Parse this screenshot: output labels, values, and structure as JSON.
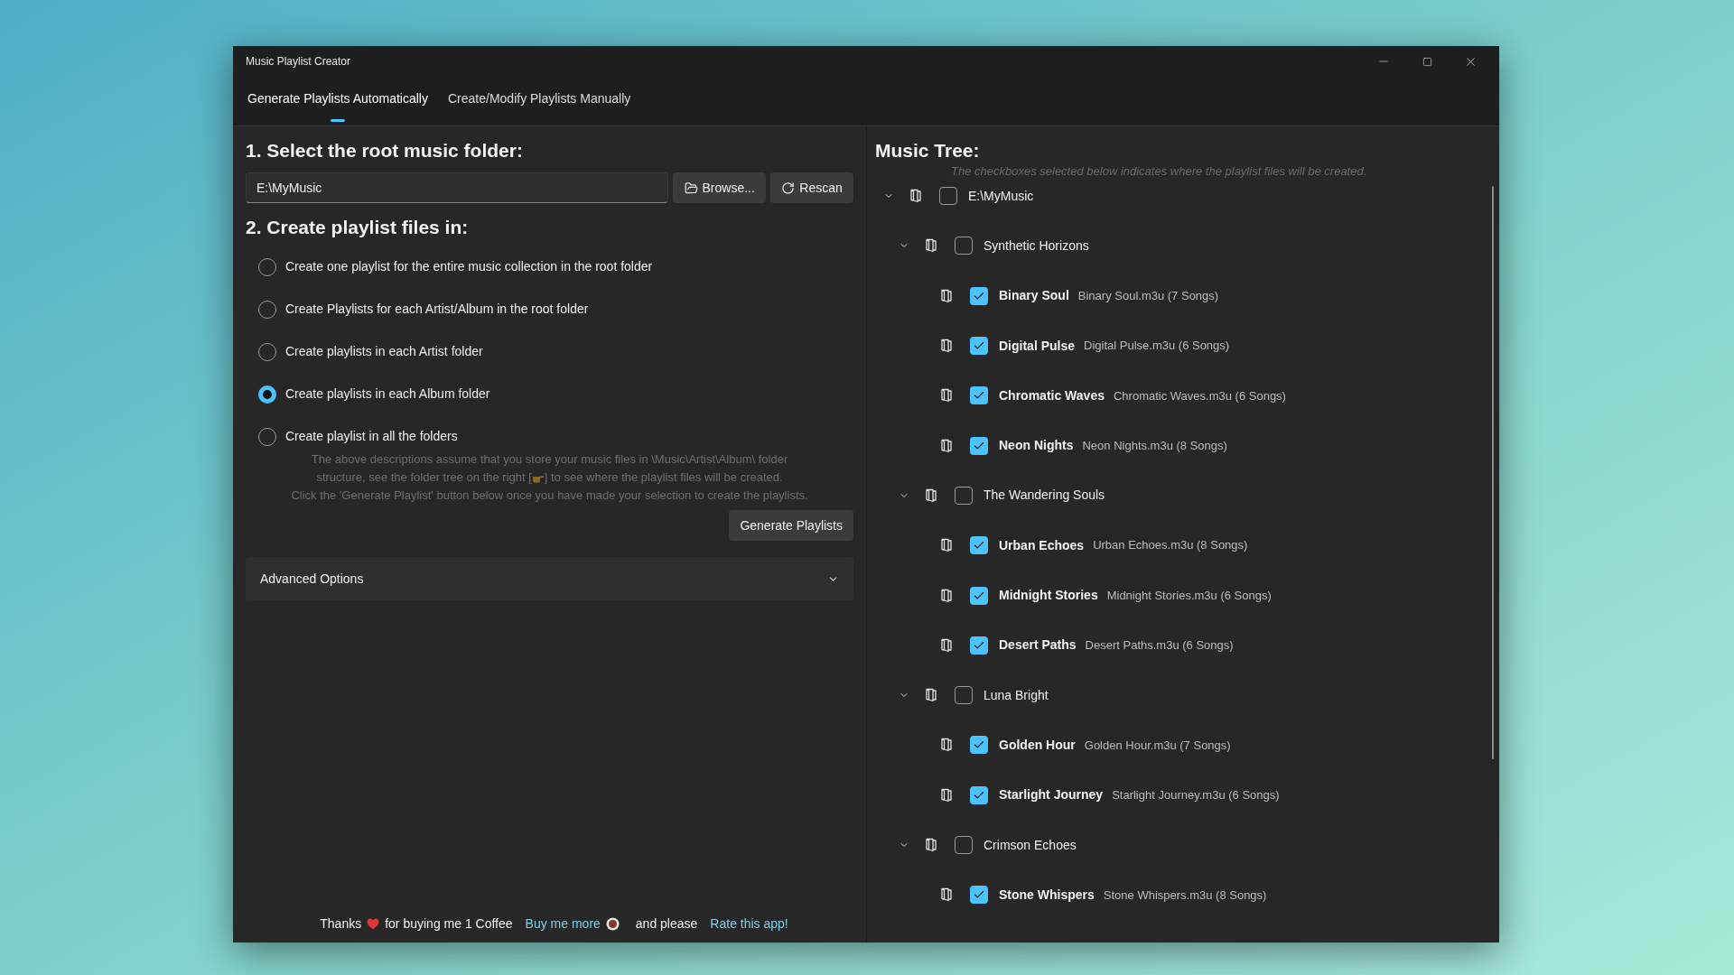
{
  "window": {
    "title": "Music Playlist Creator"
  },
  "tabs": [
    {
      "label": "Generate Playlists Automatically",
      "selected": true
    },
    {
      "label": "Create/Modify Playlists Manually",
      "selected": false
    }
  ],
  "step_1": {
    "heading": "1. Select the root music folder:",
    "folder_value": "E:\\MyMusic",
    "browse_button": "Browse...",
    "rescan_button": "Rescan"
  },
  "step_2": {
    "heading": "2. Create playlist files in:",
    "options": [
      {
        "label": "Create one playlist for the entire music collection in the root folder",
        "selected": false
      },
      {
        "label": "Create Playlists for each Artist/Album in the root folder",
        "selected": false
      },
      {
        "label": "Create playlists in each Artist folder",
        "selected": false
      },
      {
        "label": "Create playlists in each Album folder",
        "selected": true
      },
      {
        "label": "Create playlist in all the folders",
        "selected": false
      }
    ],
    "description": {
      "line_1": "The above descriptions assume that you store your music files in \\Music\\Artist\\Album\\ folder",
      "line_2_before": "structure, see the folder tree on the right [",
      "line_2_after": "] to see where the playlist files will be created.",
      "line_3": "Click the 'Generate Playlist' button below once you have made your selection to create the playlists."
    },
    "generate_button": "Generate Playlists",
    "advanced_options": {
      "label": "Advanced Options",
      "expanded": false
    }
  },
  "footer": {
    "thanks": "Thanks",
    "coffee_text": "for buying me 1 Coffee",
    "more_link": "Buy me more",
    "please_text": "and please",
    "rate_link": "Rate this app!"
  },
  "music_tree": {
    "heading": "Music Tree:",
    "subtitle": "The checkboxes selected below indicates where the playlist files will be created.",
    "root": {
      "label": "E:\\MyMusic",
      "checked": false,
      "expanded": true,
      "children": [
        {
          "label": "Synthetic Horizons",
          "checked": false,
          "expanded": true,
          "children": [
            {
              "label": "Binary Soul",
              "file": "Binary Soul.m3u (7 Songs)",
              "checked": true
            },
            {
              "label": "Digital Pulse",
              "file": "Digital Pulse.m3u (6 Songs)",
              "checked": true
            },
            {
              "label": "Chromatic Waves",
              "file": "Chromatic Waves.m3u (6 Songs)",
              "checked": true
            },
            {
              "label": "Neon Nights",
              "file": "Neon Nights.m3u (8 Songs)",
              "checked": true
            }
          ]
        },
        {
          "label": "The Wandering Souls",
          "checked": false,
          "expanded": true,
          "children": [
            {
              "label": "Urban Echoes",
              "file": "Urban Echoes.m3u (8 Songs)",
              "checked": true
            },
            {
              "label": "Midnight Stories",
              "file": "Midnight Stories.m3u (6 Songs)",
              "checked": true
            },
            {
              "label": "Desert Paths",
              "file": "Desert Paths.m3u (6 Songs)",
              "checked": true
            }
          ]
        },
        {
          "label": "Luna Bright",
          "checked": false,
          "expanded": true,
          "children": [
            {
              "label": "Golden Hour",
              "file": "Golden Hour.m3u (7 Songs)",
              "checked": true
            },
            {
              "label": "Starlight Journey",
              "file": "Starlight Journey.m3u (6 Songs)",
              "checked": true
            }
          ]
        },
        {
          "label": "Crimson Echoes",
          "checked": false,
          "expanded": true,
          "children": [
            {
              "label": "Stone Whispers",
              "file": "Stone Whispers.m3u (8 Songs)",
              "checked": true
            }
          ]
        }
      ]
    }
  }
}
